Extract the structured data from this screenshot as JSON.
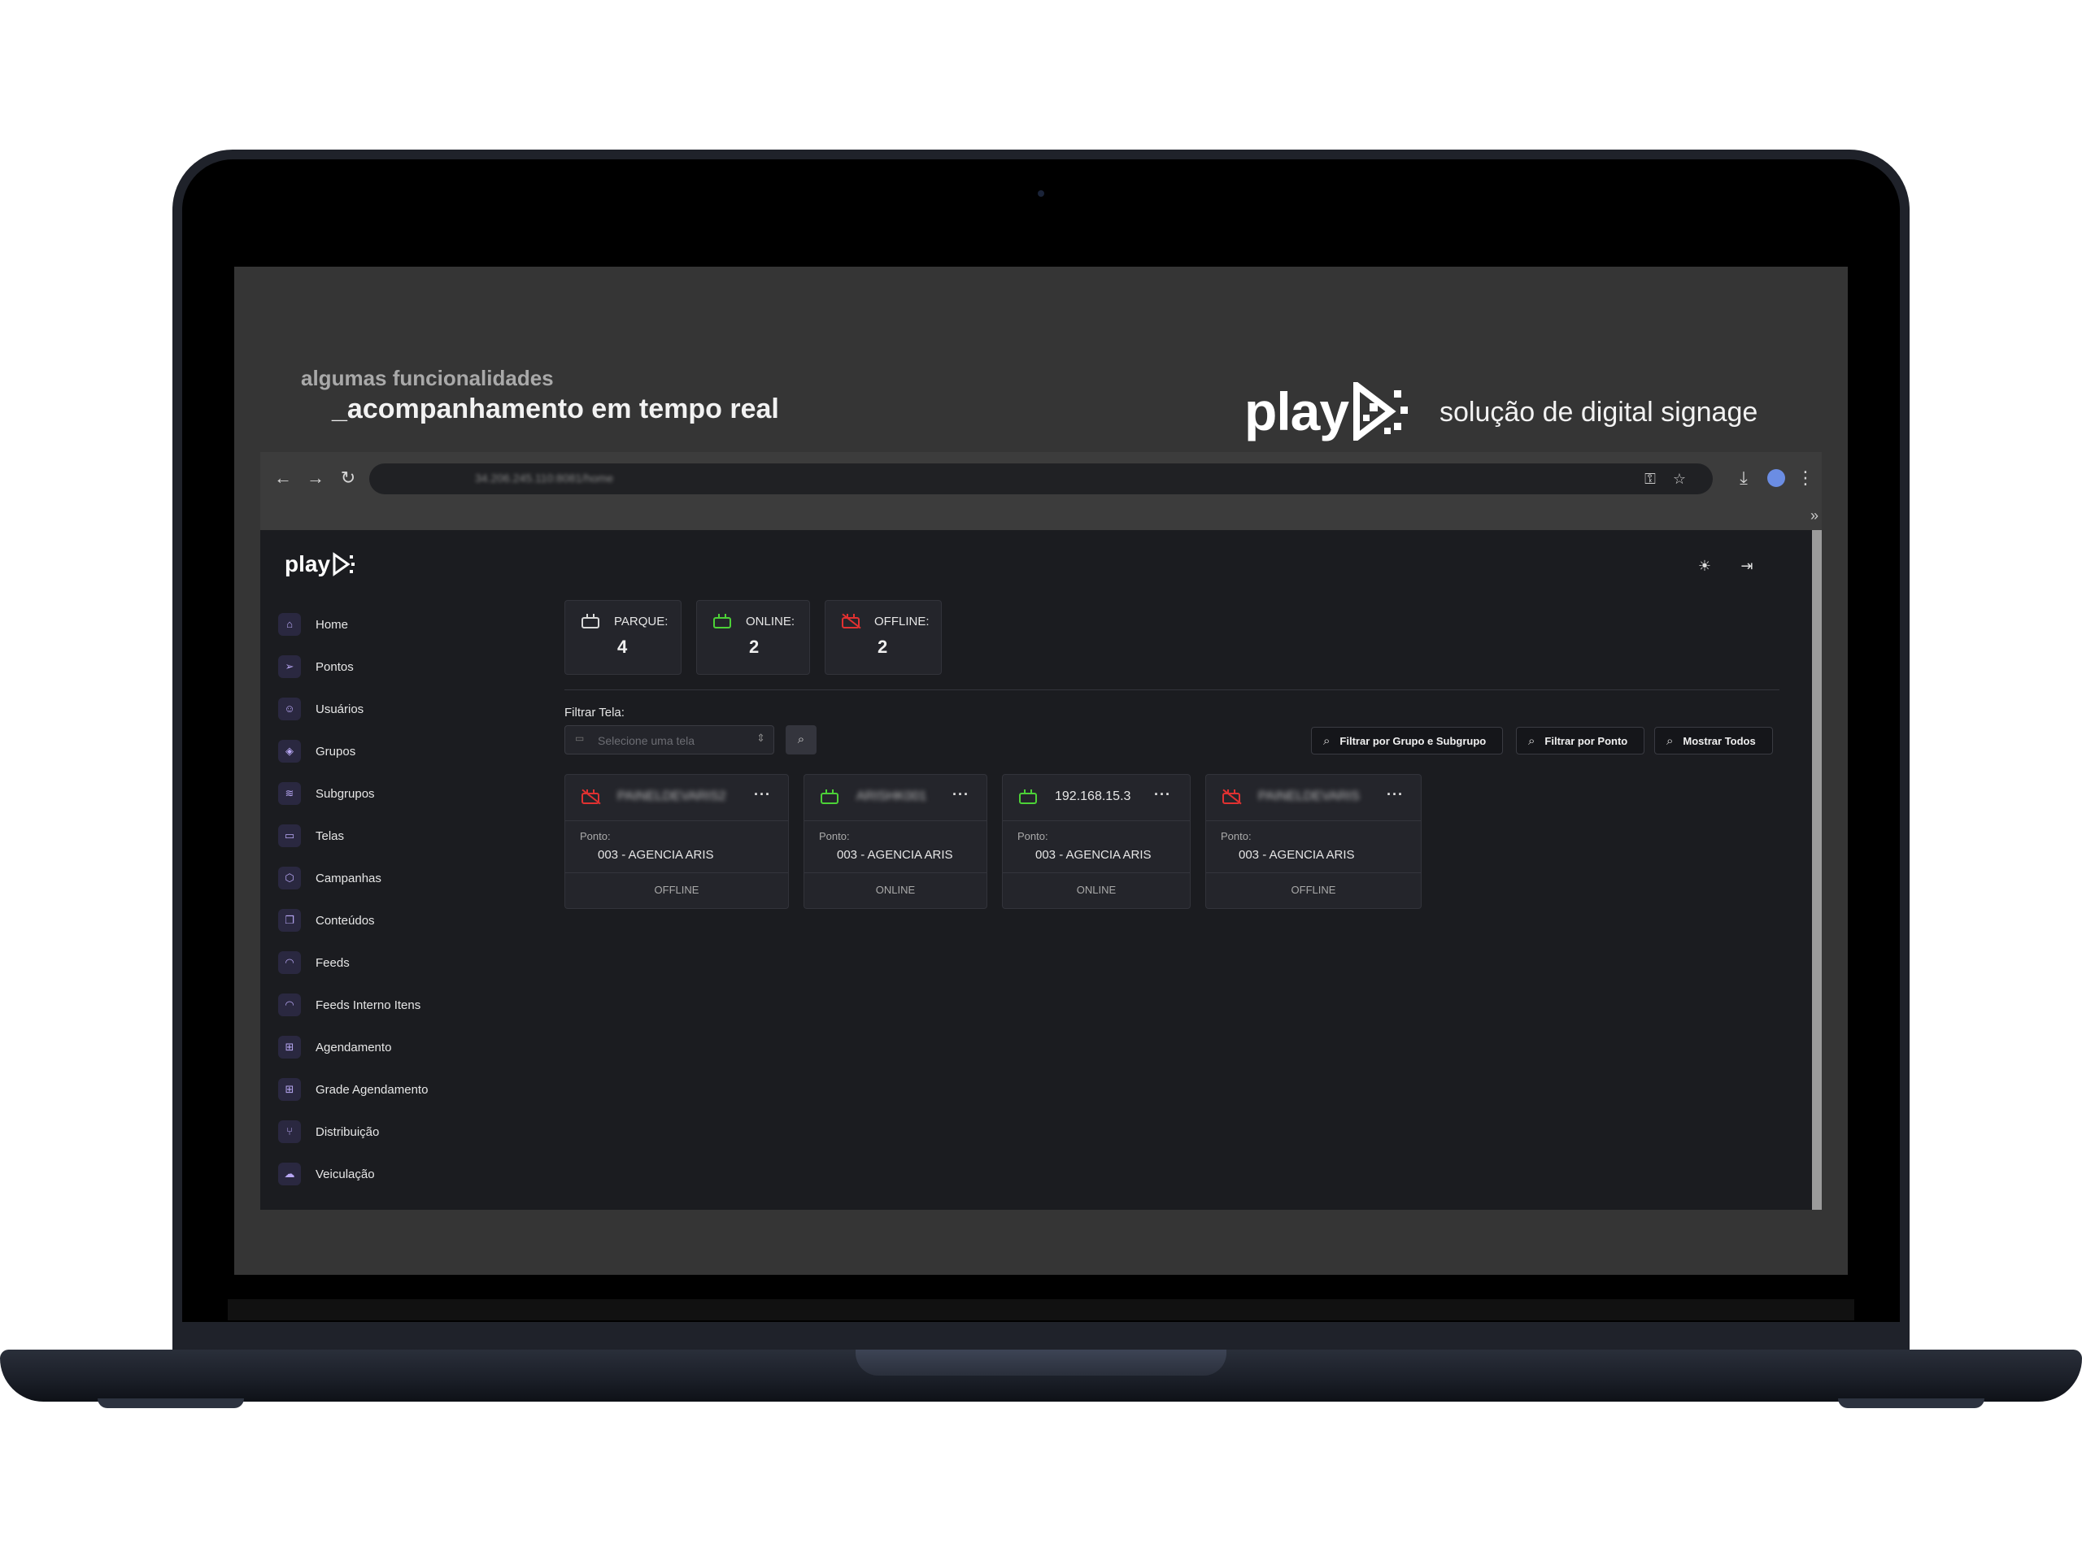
{
  "promo": {
    "line1": "algumas funcionalidades",
    "line2": "_acompanhamento em tempo real",
    "logo": "play",
    "tagline": "solução de digital signage"
  },
  "browser": {
    "address": "34.206.245.110:8081/home",
    "icons": [
      "back-icon",
      "forward-icon",
      "reload-icon",
      "key-icon",
      "star-icon",
      "download-icon",
      "profile-avatar",
      "menu-dots-icon"
    ],
    "bookmarks_more": "»"
  },
  "app": {
    "logo": "play",
    "sidebar": [
      {
        "label": "Home",
        "icon": "home-icon"
      },
      {
        "label": "Pontos",
        "icon": "send-icon"
      },
      {
        "label": "Usuários",
        "icon": "users-icon"
      },
      {
        "label": "Grupos",
        "icon": "layers-icon"
      },
      {
        "label": "Subgrupos",
        "icon": "stack-icon"
      },
      {
        "label": "Telas",
        "icon": "tv-icon"
      },
      {
        "label": "Campanhas",
        "icon": "box-icon"
      },
      {
        "label": "Conteúdos",
        "icon": "copy-icon"
      },
      {
        "label": "Feeds",
        "icon": "rss-icon"
      },
      {
        "label": "Feeds Interno Itens",
        "icon": "rss-icon"
      },
      {
        "label": "Agendamento",
        "icon": "grid-icon"
      },
      {
        "label": "Grade Agendamento",
        "icon": "grid-plus-icon"
      },
      {
        "label": "Distribuição",
        "icon": "branch-icon"
      },
      {
        "label": "Veiculação",
        "icon": "cloud-upload-icon"
      }
    ],
    "stats": [
      {
        "label": "PARQUE:",
        "value": "4",
        "color": "#d9d9d9",
        "status": "neutral"
      },
      {
        "label": "ONLINE:",
        "value": "2",
        "color": "#4cd137",
        "status": "online"
      },
      {
        "label": "OFFLINE:",
        "value": "2",
        "color": "#e03131",
        "status": "offline"
      }
    ],
    "filter": {
      "label": "Filtrar Tela:",
      "placeholder": "Selecione uma tela"
    },
    "filter_buttons": [
      {
        "label": "Filtrar por Grupo e Subgrupo"
      },
      {
        "label": "Filtrar por Ponto"
      },
      {
        "label": "Mostrar Todos"
      }
    ],
    "cards": [
      {
        "name": "PAINELDEVARIS2",
        "ponto_label": "Ponto:",
        "ponto": "003 - AGENCIA ARIS",
        "status": "OFFLINE",
        "online": false
      },
      {
        "name": "ARISHK001",
        "ponto_label": "Ponto:",
        "ponto": "003 - AGENCIA ARIS",
        "status": "ONLINE",
        "online": true
      },
      {
        "name": "192.168.15.3",
        "ponto_label": "Ponto:",
        "ponto": "003 - AGENCIA ARIS",
        "status": "ONLINE",
        "online": true
      },
      {
        "name": "PAINELDEVARIS",
        "ponto_label": "Ponto:",
        "ponto": "003 - AGENCIA ARIS",
        "status": "OFFLINE",
        "online": false
      }
    ],
    "colors": {
      "online": "#4cd137",
      "offline": "#e03131",
      "accent": "#b9a8f5"
    }
  }
}
